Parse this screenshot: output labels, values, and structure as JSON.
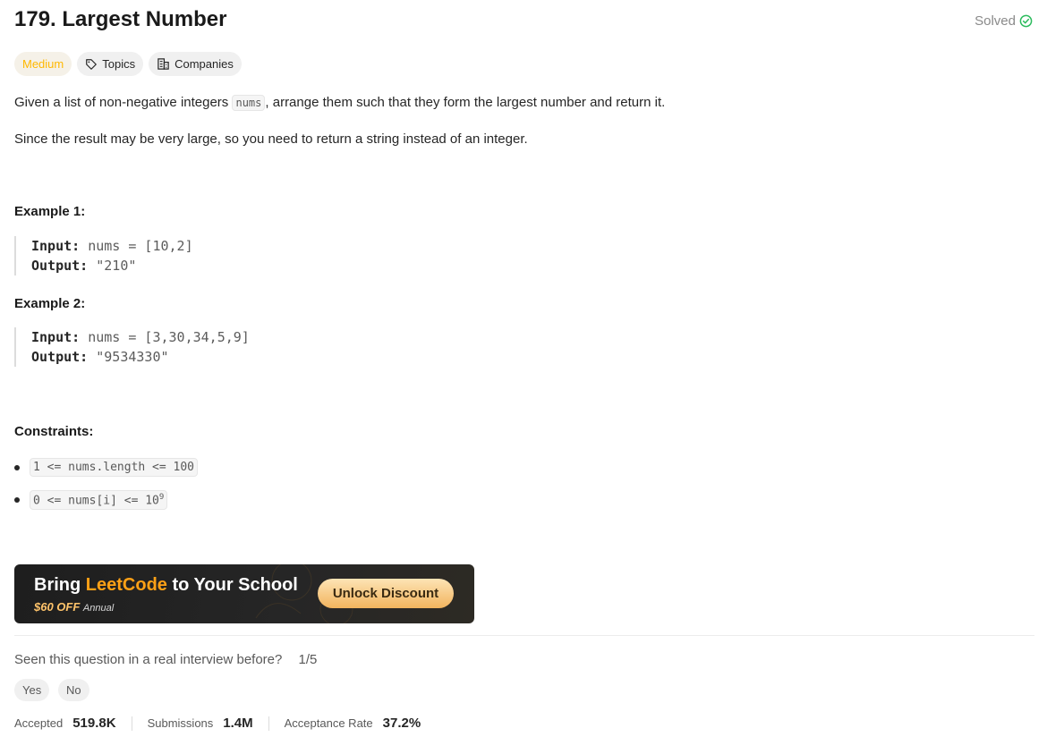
{
  "problem": {
    "title": "179. Largest Number",
    "solved_label": "Solved",
    "difficulty": "Medium",
    "topics_label": "Topics",
    "companies_label": "Companies"
  },
  "description": {
    "p1_before": "Given a list of non-negative integers",
    "p1_code": "nums",
    "p1_after": ", arrange them such that they form the largest number and return it.",
    "p2": "Since the result may be very large, so you need to return a string instead of an integer."
  },
  "examples": [
    {
      "heading": "Example 1:",
      "input_label": "Input:",
      "input_value": "nums = [10,2]",
      "output_label": "Output:",
      "output_value": "\"210\""
    },
    {
      "heading": "Example 2:",
      "input_label": "Input:",
      "input_value": "nums = [3,30,34,5,9]",
      "output_label": "Output:",
      "output_value": "\"9534330\""
    }
  ],
  "constraints": {
    "heading": "Constraints:",
    "c1": "1 <= nums.length <= 100",
    "c2_before": "0 <= nums[i] <= 10",
    "c2_sup": "9"
  },
  "banner": {
    "title_before": "Bring",
    "title_brand": "LeetCode",
    "title_after": "to Your School",
    "offer": "$60 OFF",
    "offer_note": "Annual",
    "button": "Unlock Discount"
  },
  "feedback": {
    "question": "Seen this question in a real interview before?",
    "fraction": "1/5",
    "yes": "Yes",
    "no": "No"
  },
  "stats": {
    "accepted_label": "Accepted",
    "accepted_value": "519.8K",
    "submissions_label": "Submissions",
    "submissions_value": "1.4M",
    "rate_label": "Acceptance Rate",
    "rate_value": "37.2%"
  },
  "colors": {
    "medium": "#ffb800",
    "solved_check": "#2cbb5d",
    "brand": "#ffa116",
    "banner_bg": "#1e1e1e"
  }
}
